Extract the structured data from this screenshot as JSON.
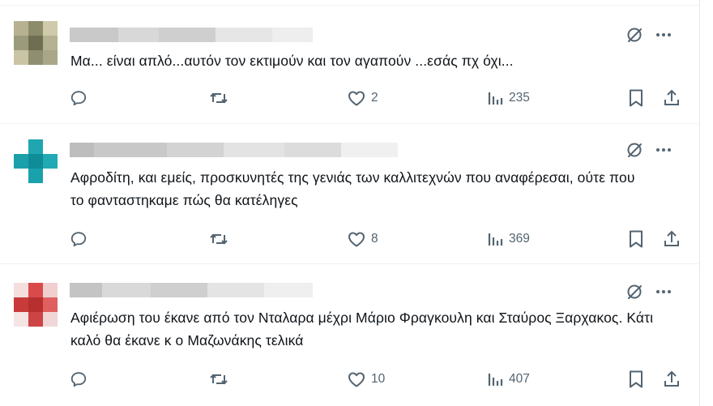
{
  "replies": [
    {
      "text": "Μα... είναι απλό...αυτόν τον εκτιμούν και τον αγαπούν ...εσάς πχ όχι...",
      "likes": "2",
      "views": "235",
      "avatar_colors": [
        "#b7b192",
        "#8d8c6a",
        "#cfcaa9",
        "#9b9a7b",
        "#6f6e52",
        "#b4b290",
        "#c9c5a4",
        "#8f8e70",
        "#a9a788"
      ]
    },
    {
      "text": "Αφροδίτη, και εμείς, προσκυνητές της γενιάς των καλλιτεχνών που αναφέρεσαι,  ούτε που το φανταστηκαμε πώς θα κατέληγες",
      "likes": "8",
      "views": "369",
      "avatar_colors": [
        "#ffffff",
        "#1fa6b0",
        "#ffffff",
        "#1aa0aa",
        "#0e8c98",
        "#22aab4",
        "#ffffff",
        "#19a2ac",
        "#ffffff"
      ]
    },
    {
      "text": "Αφιέρωση του έκανε από τον Νταλαρα μέχρι Μάριο Φραγκουλη και Σταύρος Ξαρχακος. Κάτι καλό θα έκανε κ ο Μαζωνάκης τελικά",
      "likes": "10",
      "views": "407",
      "avatar_colors": [
        "#f4dede",
        "#d94a4a",
        "#f1cfcf",
        "#c93a3a",
        "#b72f2f",
        "#e06060",
        "#f5e4e4",
        "#cc4444",
        "#f0d6d6"
      ]
    }
  ],
  "icons": {
    "grok": "grok-icon",
    "more": "more-icon",
    "reply": "reply-icon",
    "repost": "repost-icon",
    "like": "heart-icon",
    "views": "views-icon",
    "bookmark": "bookmark-icon",
    "share": "share-icon"
  }
}
